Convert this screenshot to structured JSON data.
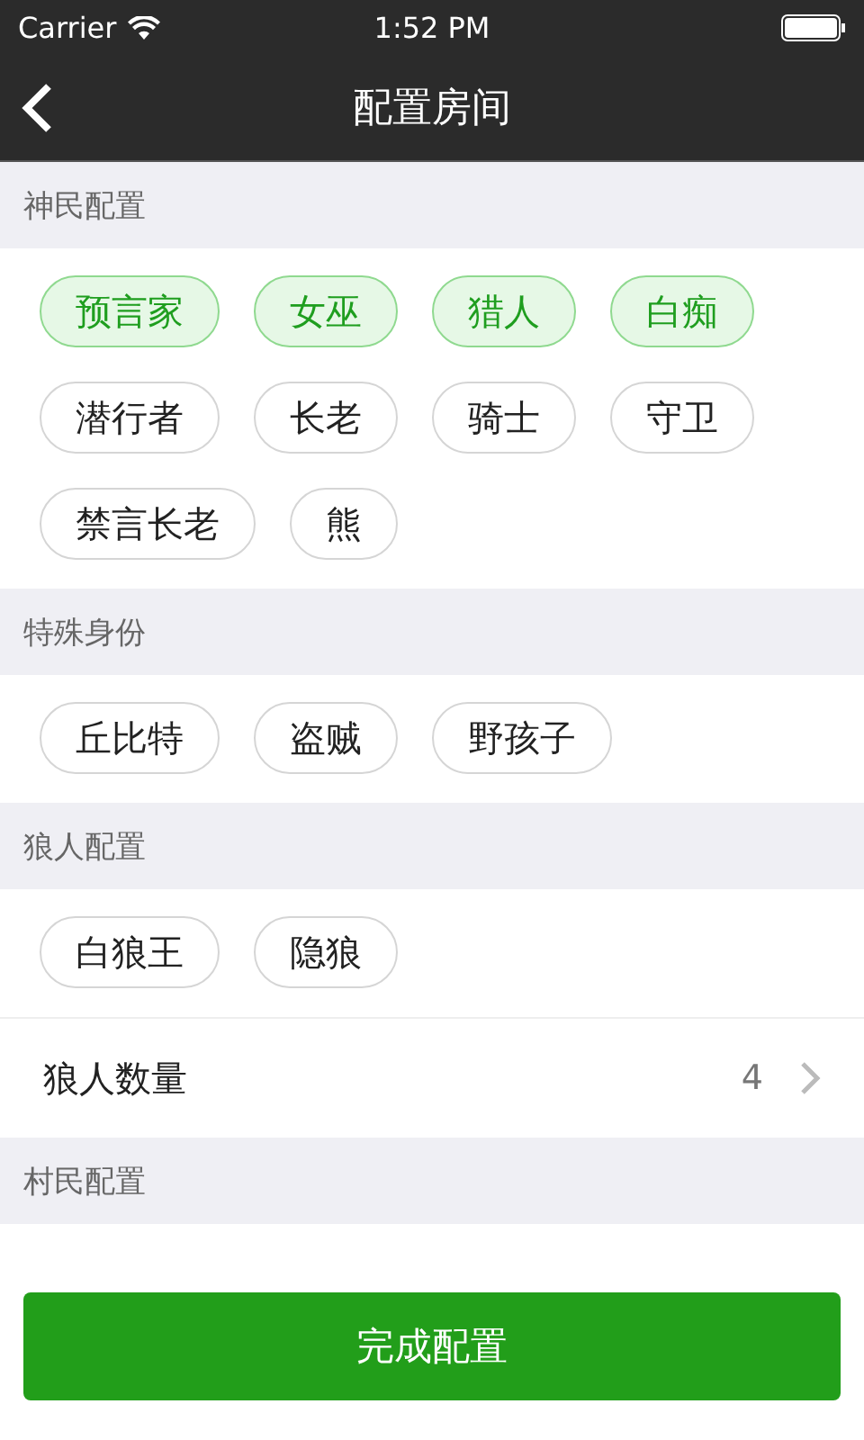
{
  "status_bar": {
    "carrier": "Carrier",
    "time": "1:52 PM"
  },
  "nav": {
    "title": "配置房间"
  },
  "sections": [
    {
      "title": "神民配置",
      "roles": [
        {
          "label": "预言家",
          "selected": true
        },
        {
          "label": "女巫",
          "selected": true
        },
        {
          "label": "猎人",
          "selected": true
        },
        {
          "label": "白痴",
          "selected": true
        },
        {
          "label": "潜行者",
          "selected": false
        },
        {
          "label": "长老",
          "selected": false
        },
        {
          "label": "骑士",
          "selected": false
        },
        {
          "label": "守卫",
          "selected": false
        },
        {
          "label": "禁言长老",
          "selected": false
        },
        {
          "label": "熊",
          "selected": false
        }
      ]
    },
    {
      "title": "特殊身份",
      "roles": [
        {
          "label": "丘比特",
          "selected": false
        },
        {
          "label": "盗贼",
          "selected": false
        },
        {
          "label": "野孩子",
          "selected": false
        }
      ]
    },
    {
      "title": "狼人配置",
      "roles": [
        {
          "label": "白狼王",
          "selected": false
        },
        {
          "label": "隐狼",
          "selected": false
        }
      ],
      "count_row": {
        "label": "狼人数量",
        "value": "4"
      }
    },
    {
      "title": "村民配置"
    }
  ],
  "done_button": "完成配置"
}
